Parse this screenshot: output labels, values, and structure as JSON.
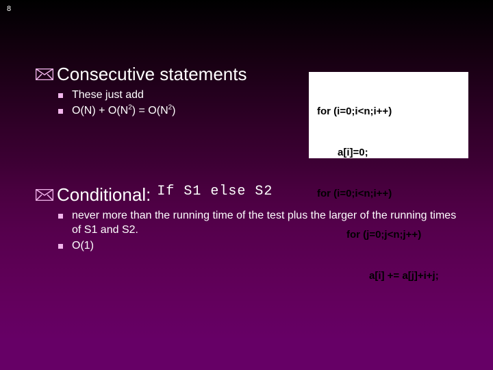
{
  "slide": {
    "page_number": "8",
    "background_top_color": "#000000",
    "background_bottom_color": "#660066",
    "text_color": "#ffffff",
    "bullet_color": "#f2b6ec"
  },
  "sections": [
    {
      "icon": "envelope-icon",
      "heading": "Consecutive statements",
      "heading_mono": "",
      "bullets": [
        {
          "text": "These just add",
          "html": "These just add"
        },
        {
          "text": "O(N) + O(N2) = O(N2)",
          "html": "O(N) + O(N<sup>2</sup>) = O(N<sup>2</sup>)"
        }
      ]
    },
    {
      "icon": "envelope-icon",
      "heading": "Conditional:",
      "heading_mono": "If S1 else S2",
      "bullets": [
        {
          "text": "never more than the running time of the test plus the larger of the running times of S1 and S2.",
          "html": "never more than the running time of the test plus the larger of the running times of S1 and S2."
        },
        {
          "text": "O(1)",
          "html": "O(1)"
        }
      ]
    }
  ],
  "code_panel": {
    "background": "#ffffff",
    "foreground": "#000000",
    "lines": [
      {
        "indent": 0,
        "text": "for (i=0;i<n;i++)"
      },
      {
        "indent": 1,
        "text": "a[i]=0;"
      },
      {
        "indent": 0,
        "text": "for (i=0;i<n;i++)"
      },
      {
        "indent": 2,
        "text": "for (j=0;j<n;j++)"
      },
      {
        "indent": 3,
        "text": "a[i] += a[j]+i+j;"
      }
    ]
  }
}
